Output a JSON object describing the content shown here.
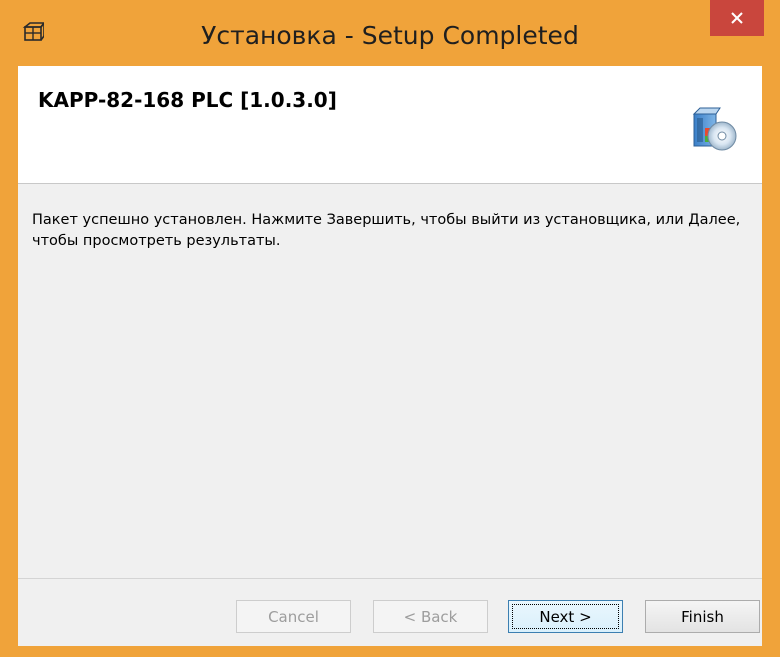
{
  "window": {
    "title": "Установка - Setup Completed",
    "accent_color": "#f0a33a",
    "close_color": "#c9463d",
    "close_glyph": "×"
  },
  "header": {
    "product_title": "KAPP-82-168 PLC [1.0.3.0]",
    "icon": "setup-cd-icon"
  },
  "content": {
    "message": "Пакет успешно установлен. Нажмите Завершить, чтобы выйти из установщика, или Далее, чтобы просмотреть результаты."
  },
  "buttons": {
    "cancel_label": "Cancel",
    "back_label": "< Back",
    "next_label": "Next >",
    "finish_label": "Finish"
  }
}
